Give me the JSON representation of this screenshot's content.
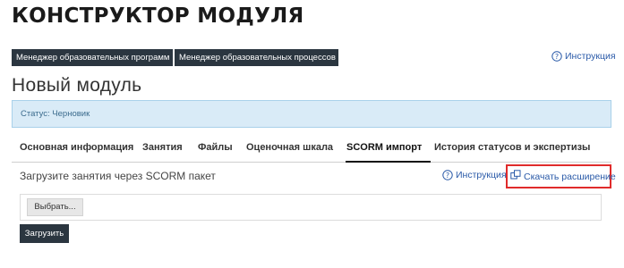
{
  "header": {
    "title": "КОНСТРУКТОР МОДУЛЯ",
    "manager_programs": "Менеджер образовательных программ",
    "manager_processes": "Менеджер образовательных процессов",
    "help_label": "Инструкция"
  },
  "module": {
    "title": "Новый модуль",
    "status": "Статус: Черновик"
  },
  "tabs": [
    {
      "label": "Основная информация"
    },
    {
      "label": "Занятия"
    },
    {
      "label": "Файлы"
    },
    {
      "label": "Оценочная шкала"
    },
    {
      "label": "SCORM импорт"
    },
    {
      "label": "История статусов и экспертизы"
    }
  ],
  "active_tab": "SCORM импорт",
  "scorm": {
    "section_title": "Загрузите занятия через SCORM пакет",
    "help_label": "Инструкция",
    "download_extension": "Скачать расширение",
    "choose_button": "Выбрать...",
    "upload_button": "Загрузить"
  },
  "icons": {
    "help": "question-circle-icon",
    "extension": "puzzle-extension-icon"
  },
  "colors": {
    "dark_button": "#2b3640",
    "link": "#2a5aa8",
    "status_bg": "#d9ebf7",
    "highlight_border": "#e02b2b"
  }
}
